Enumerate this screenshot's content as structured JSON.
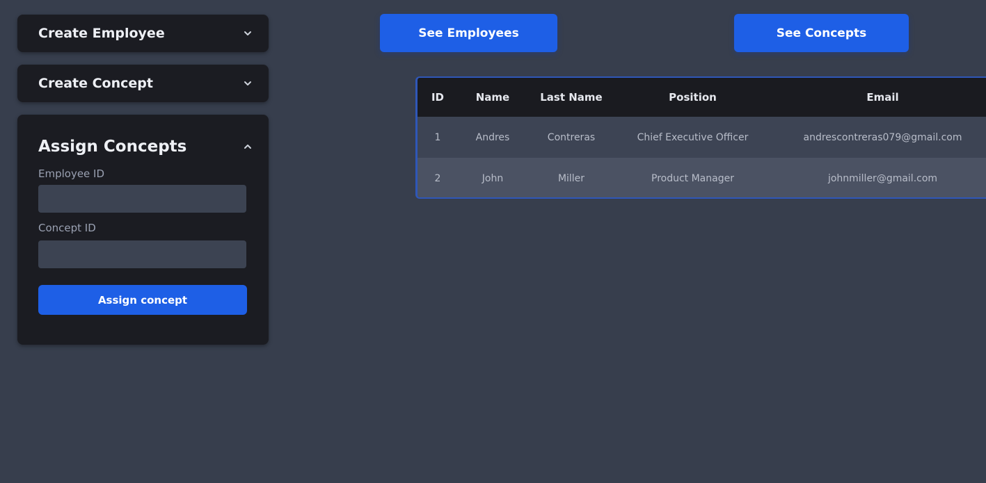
{
  "sidebar": {
    "create_employee": {
      "title": "Create Employee"
    },
    "create_concept": {
      "title": "Create Concept"
    },
    "assign_concepts": {
      "title": "Assign Concepts",
      "employee_id_label": "Employee ID",
      "employee_id_value": "",
      "concept_id_label": "Concept ID",
      "concept_id_value": "",
      "submit_label": "Assign concept"
    }
  },
  "header": {
    "see_employees_label": "See Employees",
    "see_concepts_label": "See Concepts"
  },
  "table": {
    "columns": [
      "ID",
      "Name",
      "Last Name",
      "Position",
      "Email"
    ],
    "rows": [
      [
        "1",
        "Andres",
        "Contreras",
        "Chief Executive Officer",
        "andrescontreras079@gmail.com"
      ],
      [
        "2",
        "John",
        "Miller",
        "Product Manager",
        "johnmiller@gmail.com"
      ]
    ]
  },
  "colors": {
    "background": "#373e4d",
    "panel": "#1b1c22",
    "accent": "#1e5fe6"
  },
  "icons": {
    "collapsed": "chevron-down-icon",
    "expanded": "chevron-up-icon"
  }
}
